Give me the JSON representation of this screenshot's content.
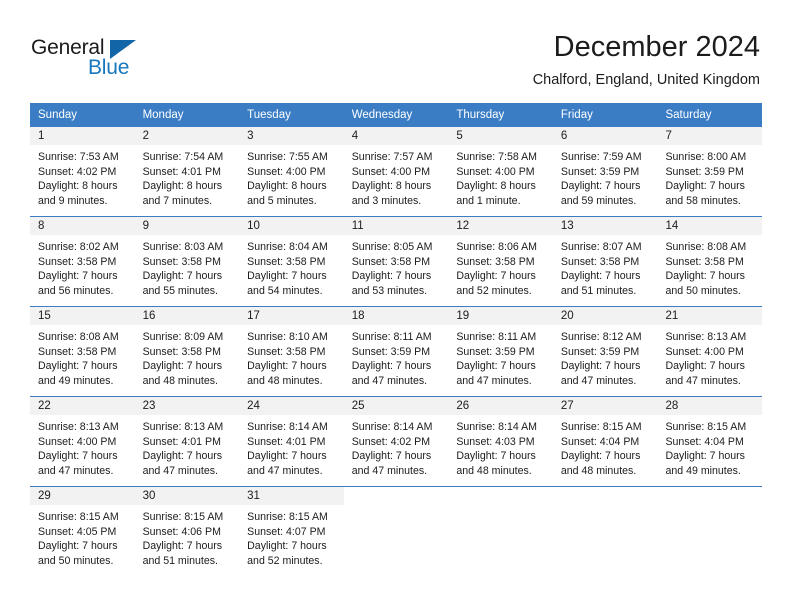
{
  "brand": {
    "word_one": "General",
    "word_two": "Blue",
    "accent_color": "#1878be",
    "triangle_color": "#1266a8"
  },
  "header": {
    "month_title": "December 2024",
    "location": "Chalford, England, United Kingdom"
  },
  "calendar": {
    "header_color": "#3b7dc4",
    "weekdays": [
      "Sunday",
      "Monday",
      "Tuesday",
      "Wednesday",
      "Thursday",
      "Friday",
      "Saturday"
    ],
    "weeks": [
      [
        {
          "day": "1",
          "sunrise": "Sunrise: 7:53 AM",
          "sunset": "Sunset: 4:02 PM",
          "daylight_1": "Daylight: 8 hours",
          "daylight_2": "and 9 minutes."
        },
        {
          "day": "2",
          "sunrise": "Sunrise: 7:54 AM",
          "sunset": "Sunset: 4:01 PM",
          "daylight_1": "Daylight: 8 hours",
          "daylight_2": "and 7 minutes."
        },
        {
          "day": "3",
          "sunrise": "Sunrise: 7:55 AM",
          "sunset": "Sunset: 4:00 PM",
          "daylight_1": "Daylight: 8 hours",
          "daylight_2": "and 5 minutes."
        },
        {
          "day": "4",
          "sunrise": "Sunrise: 7:57 AM",
          "sunset": "Sunset: 4:00 PM",
          "daylight_1": "Daylight: 8 hours",
          "daylight_2": "and 3 minutes."
        },
        {
          "day": "5",
          "sunrise": "Sunrise: 7:58 AM",
          "sunset": "Sunset: 4:00 PM",
          "daylight_1": "Daylight: 8 hours",
          "daylight_2": "and 1 minute."
        },
        {
          "day": "6",
          "sunrise": "Sunrise: 7:59 AM",
          "sunset": "Sunset: 3:59 PM",
          "daylight_1": "Daylight: 7 hours",
          "daylight_2": "and 59 minutes."
        },
        {
          "day": "7",
          "sunrise": "Sunrise: 8:00 AM",
          "sunset": "Sunset: 3:59 PM",
          "daylight_1": "Daylight: 7 hours",
          "daylight_2": "and 58 minutes."
        }
      ],
      [
        {
          "day": "8",
          "sunrise": "Sunrise: 8:02 AM",
          "sunset": "Sunset: 3:58 PM",
          "daylight_1": "Daylight: 7 hours",
          "daylight_2": "and 56 minutes."
        },
        {
          "day": "9",
          "sunrise": "Sunrise: 8:03 AM",
          "sunset": "Sunset: 3:58 PM",
          "daylight_1": "Daylight: 7 hours",
          "daylight_2": "and 55 minutes."
        },
        {
          "day": "10",
          "sunrise": "Sunrise: 8:04 AM",
          "sunset": "Sunset: 3:58 PM",
          "daylight_1": "Daylight: 7 hours",
          "daylight_2": "and 54 minutes."
        },
        {
          "day": "11",
          "sunrise": "Sunrise: 8:05 AM",
          "sunset": "Sunset: 3:58 PM",
          "daylight_1": "Daylight: 7 hours",
          "daylight_2": "and 53 minutes."
        },
        {
          "day": "12",
          "sunrise": "Sunrise: 8:06 AM",
          "sunset": "Sunset: 3:58 PM",
          "daylight_1": "Daylight: 7 hours",
          "daylight_2": "and 52 minutes."
        },
        {
          "day": "13",
          "sunrise": "Sunrise: 8:07 AM",
          "sunset": "Sunset: 3:58 PM",
          "daylight_1": "Daylight: 7 hours",
          "daylight_2": "and 51 minutes."
        },
        {
          "day": "14",
          "sunrise": "Sunrise: 8:08 AM",
          "sunset": "Sunset: 3:58 PM",
          "daylight_1": "Daylight: 7 hours",
          "daylight_2": "and 50 minutes."
        }
      ],
      [
        {
          "day": "15",
          "sunrise": "Sunrise: 8:08 AM",
          "sunset": "Sunset: 3:58 PM",
          "daylight_1": "Daylight: 7 hours",
          "daylight_2": "and 49 minutes."
        },
        {
          "day": "16",
          "sunrise": "Sunrise: 8:09 AM",
          "sunset": "Sunset: 3:58 PM",
          "daylight_1": "Daylight: 7 hours",
          "daylight_2": "and 48 minutes."
        },
        {
          "day": "17",
          "sunrise": "Sunrise: 8:10 AM",
          "sunset": "Sunset: 3:58 PM",
          "daylight_1": "Daylight: 7 hours",
          "daylight_2": "and 48 minutes."
        },
        {
          "day": "18",
          "sunrise": "Sunrise: 8:11 AM",
          "sunset": "Sunset: 3:59 PM",
          "daylight_1": "Daylight: 7 hours",
          "daylight_2": "and 47 minutes."
        },
        {
          "day": "19",
          "sunrise": "Sunrise: 8:11 AM",
          "sunset": "Sunset: 3:59 PM",
          "daylight_1": "Daylight: 7 hours",
          "daylight_2": "and 47 minutes."
        },
        {
          "day": "20",
          "sunrise": "Sunrise: 8:12 AM",
          "sunset": "Sunset: 3:59 PM",
          "daylight_1": "Daylight: 7 hours",
          "daylight_2": "and 47 minutes."
        },
        {
          "day": "21",
          "sunrise": "Sunrise: 8:13 AM",
          "sunset": "Sunset: 4:00 PM",
          "daylight_1": "Daylight: 7 hours",
          "daylight_2": "and 47 minutes."
        }
      ],
      [
        {
          "day": "22",
          "sunrise": "Sunrise: 8:13 AM",
          "sunset": "Sunset: 4:00 PM",
          "daylight_1": "Daylight: 7 hours",
          "daylight_2": "and 47 minutes."
        },
        {
          "day": "23",
          "sunrise": "Sunrise: 8:13 AM",
          "sunset": "Sunset: 4:01 PM",
          "daylight_1": "Daylight: 7 hours",
          "daylight_2": "and 47 minutes."
        },
        {
          "day": "24",
          "sunrise": "Sunrise: 8:14 AM",
          "sunset": "Sunset: 4:01 PM",
          "daylight_1": "Daylight: 7 hours",
          "daylight_2": "and 47 minutes."
        },
        {
          "day": "25",
          "sunrise": "Sunrise: 8:14 AM",
          "sunset": "Sunset: 4:02 PM",
          "daylight_1": "Daylight: 7 hours",
          "daylight_2": "and 47 minutes."
        },
        {
          "day": "26",
          "sunrise": "Sunrise: 8:14 AM",
          "sunset": "Sunset: 4:03 PM",
          "daylight_1": "Daylight: 7 hours",
          "daylight_2": "and 48 minutes."
        },
        {
          "day": "27",
          "sunrise": "Sunrise: 8:15 AM",
          "sunset": "Sunset: 4:04 PM",
          "daylight_1": "Daylight: 7 hours",
          "daylight_2": "and 48 minutes."
        },
        {
          "day": "28",
          "sunrise": "Sunrise: 8:15 AM",
          "sunset": "Sunset: 4:04 PM",
          "daylight_1": "Daylight: 7 hours",
          "daylight_2": "and 49 minutes."
        }
      ],
      [
        {
          "day": "29",
          "sunrise": "Sunrise: 8:15 AM",
          "sunset": "Sunset: 4:05 PM",
          "daylight_1": "Daylight: 7 hours",
          "daylight_2": "and 50 minutes."
        },
        {
          "day": "30",
          "sunrise": "Sunrise: 8:15 AM",
          "sunset": "Sunset: 4:06 PM",
          "daylight_1": "Daylight: 7 hours",
          "daylight_2": "and 51 minutes."
        },
        {
          "day": "31",
          "sunrise": "Sunrise: 8:15 AM",
          "sunset": "Sunset: 4:07 PM",
          "daylight_1": "Daylight: 7 hours",
          "daylight_2": "and 52 minutes."
        },
        {
          "day": "",
          "sunrise": "",
          "sunset": "",
          "daylight_1": "",
          "daylight_2": ""
        },
        {
          "day": "",
          "sunrise": "",
          "sunset": "",
          "daylight_1": "",
          "daylight_2": ""
        },
        {
          "day": "",
          "sunrise": "",
          "sunset": "",
          "daylight_1": "",
          "daylight_2": ""
        },
        {
          "day": "",
          "sunrise": "",
          "sunset": "",
          "daylight_1": "",
          "daylight_2": ""
        }
      ]
    ]
  }
}
